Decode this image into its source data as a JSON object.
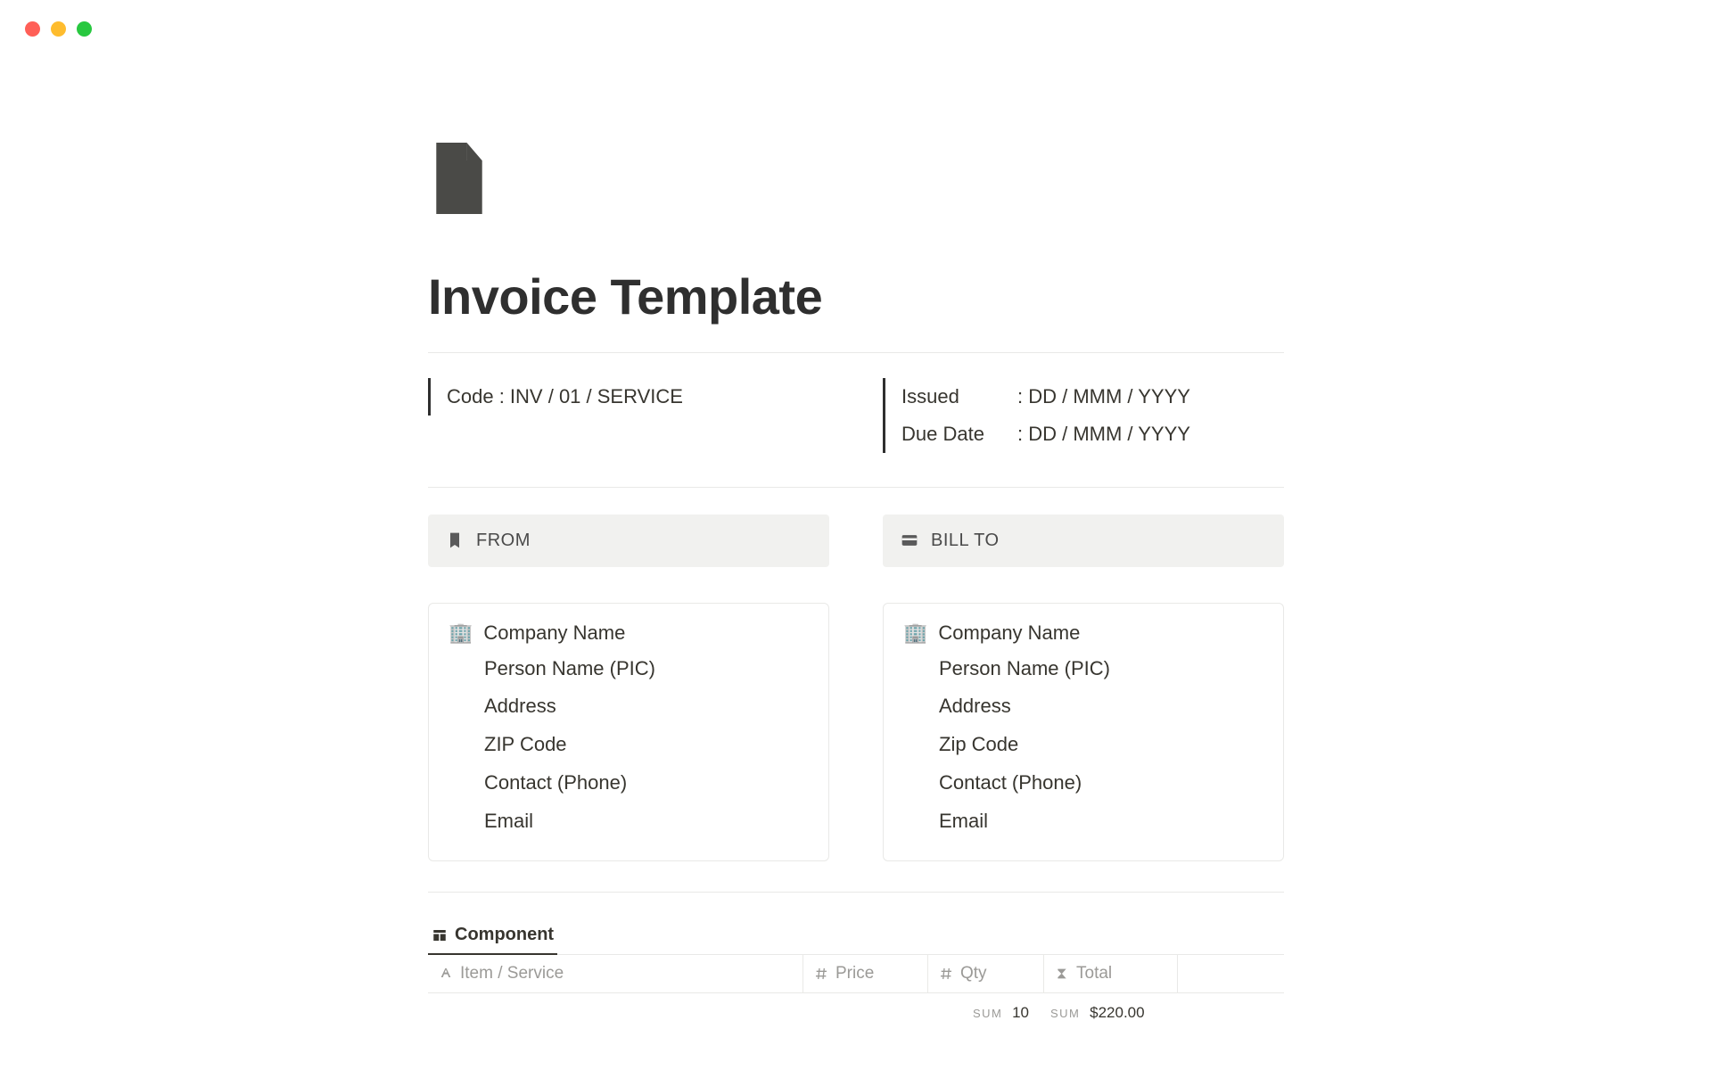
{
  "title": "Invoice Template",
  "code": {
    "full": "Code : INV / 01 / SERVICE"
  },
  "issued": {
    "label": "Issued",
    "value": ": DD / MMM / YYYY"
  },
  "due": {
    "label": "Due Date",
    "value": ": DD / MMM / YYYY"
  },
  "from": {
    "heading": "FROM",
    "company": "Company Name",
    "person": "Person Name (PIC)",
    "address": "Address",
    "zip": "ZIP Code",
    "contact": "Contact (Phone)",
    "email": "Email"
  },
  "billto": {
    "heading": "BILL TO",
    "company": "Company Name",
    "person": "Person Name (PIC)",
    "address": "Address",
    "zip": "Zip Code",
    "contact": "Contact (Phone)",
    "email": "Email"
  },
  "db": {
    "tab": "Component",
    "columns": {
      "item": "Item / Service",
      "price": "Price",
      "qty": "Qty",
      "total": "Total"
    },
    "sum_label": "SUM",
    "sum_qty": "10",
    "sum_total": "$220.00"
  }
}
